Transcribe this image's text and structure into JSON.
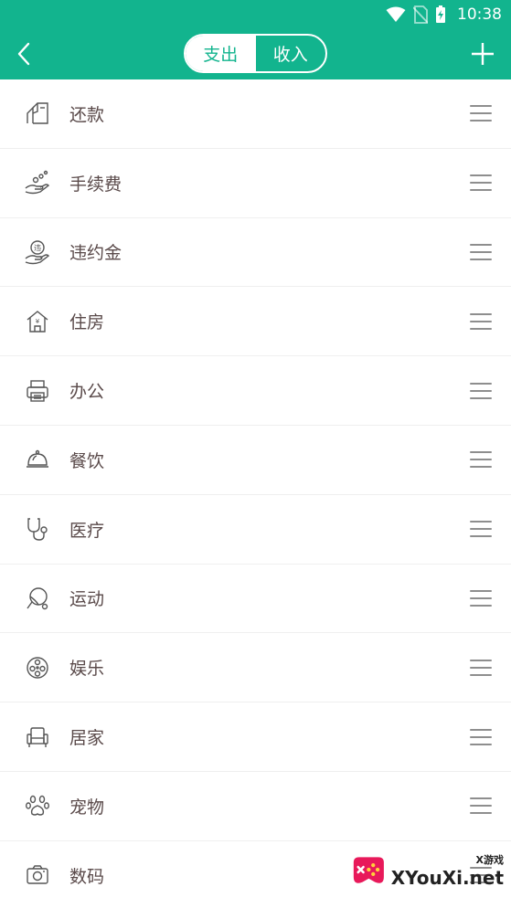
{
  "status_bar": {
    "time": "10:38",
    "icons": [
      "wifi-icon",
      "no-sim-icon",
      "battery-charging-icon"
    ]
  },
  "header": {
    "back_icon": "chevron-left-icon",
    "add_icon": "plus-icon",
    "tabs": [
      {
        "label": "支出",
        "selected": true
      },
      {
        "label": "收入",
        "selected": false
      }
    ],
    "accent_color": "#12b48e"
  },
  "categories": [
    {
      "label": "还款",
      "icon": "repayment-icon"
    },
    {
      "label": "手续费",
      "icon": "fee-hand-icon"
    },
    {
      "label": "违约金",
      "icon": "penalty-hand-icon"
    },
    {
      "label": "住房",
      "icon": "house-icon"
    },
    {
      "label": "办公",
      "icon": "printer-icon"
    },
    {
      "label": "餐饮",
      "icon": "dining-bell-icon"
    },
    {
      "label": "医疗",
      "icon": "stethoscope-icon"
    },
    {
      "label": "运动",
      "icon": "racket-icon"
    },
    {
      "label": "娱乐",
      "icon": "film-reel-icon"
    },
    {
      "label": "居家",
      "icon": "armchair-icon"
    },
    {
      "label": "宠物",
      "icon": "paw-icon"
    },
    {
      "label": "数码",
      "icon": "camera-icon"
    }
  ],
  "watermark": {
    "small": "X游戏",
    "big": "XYouXi.net"
  }
}
